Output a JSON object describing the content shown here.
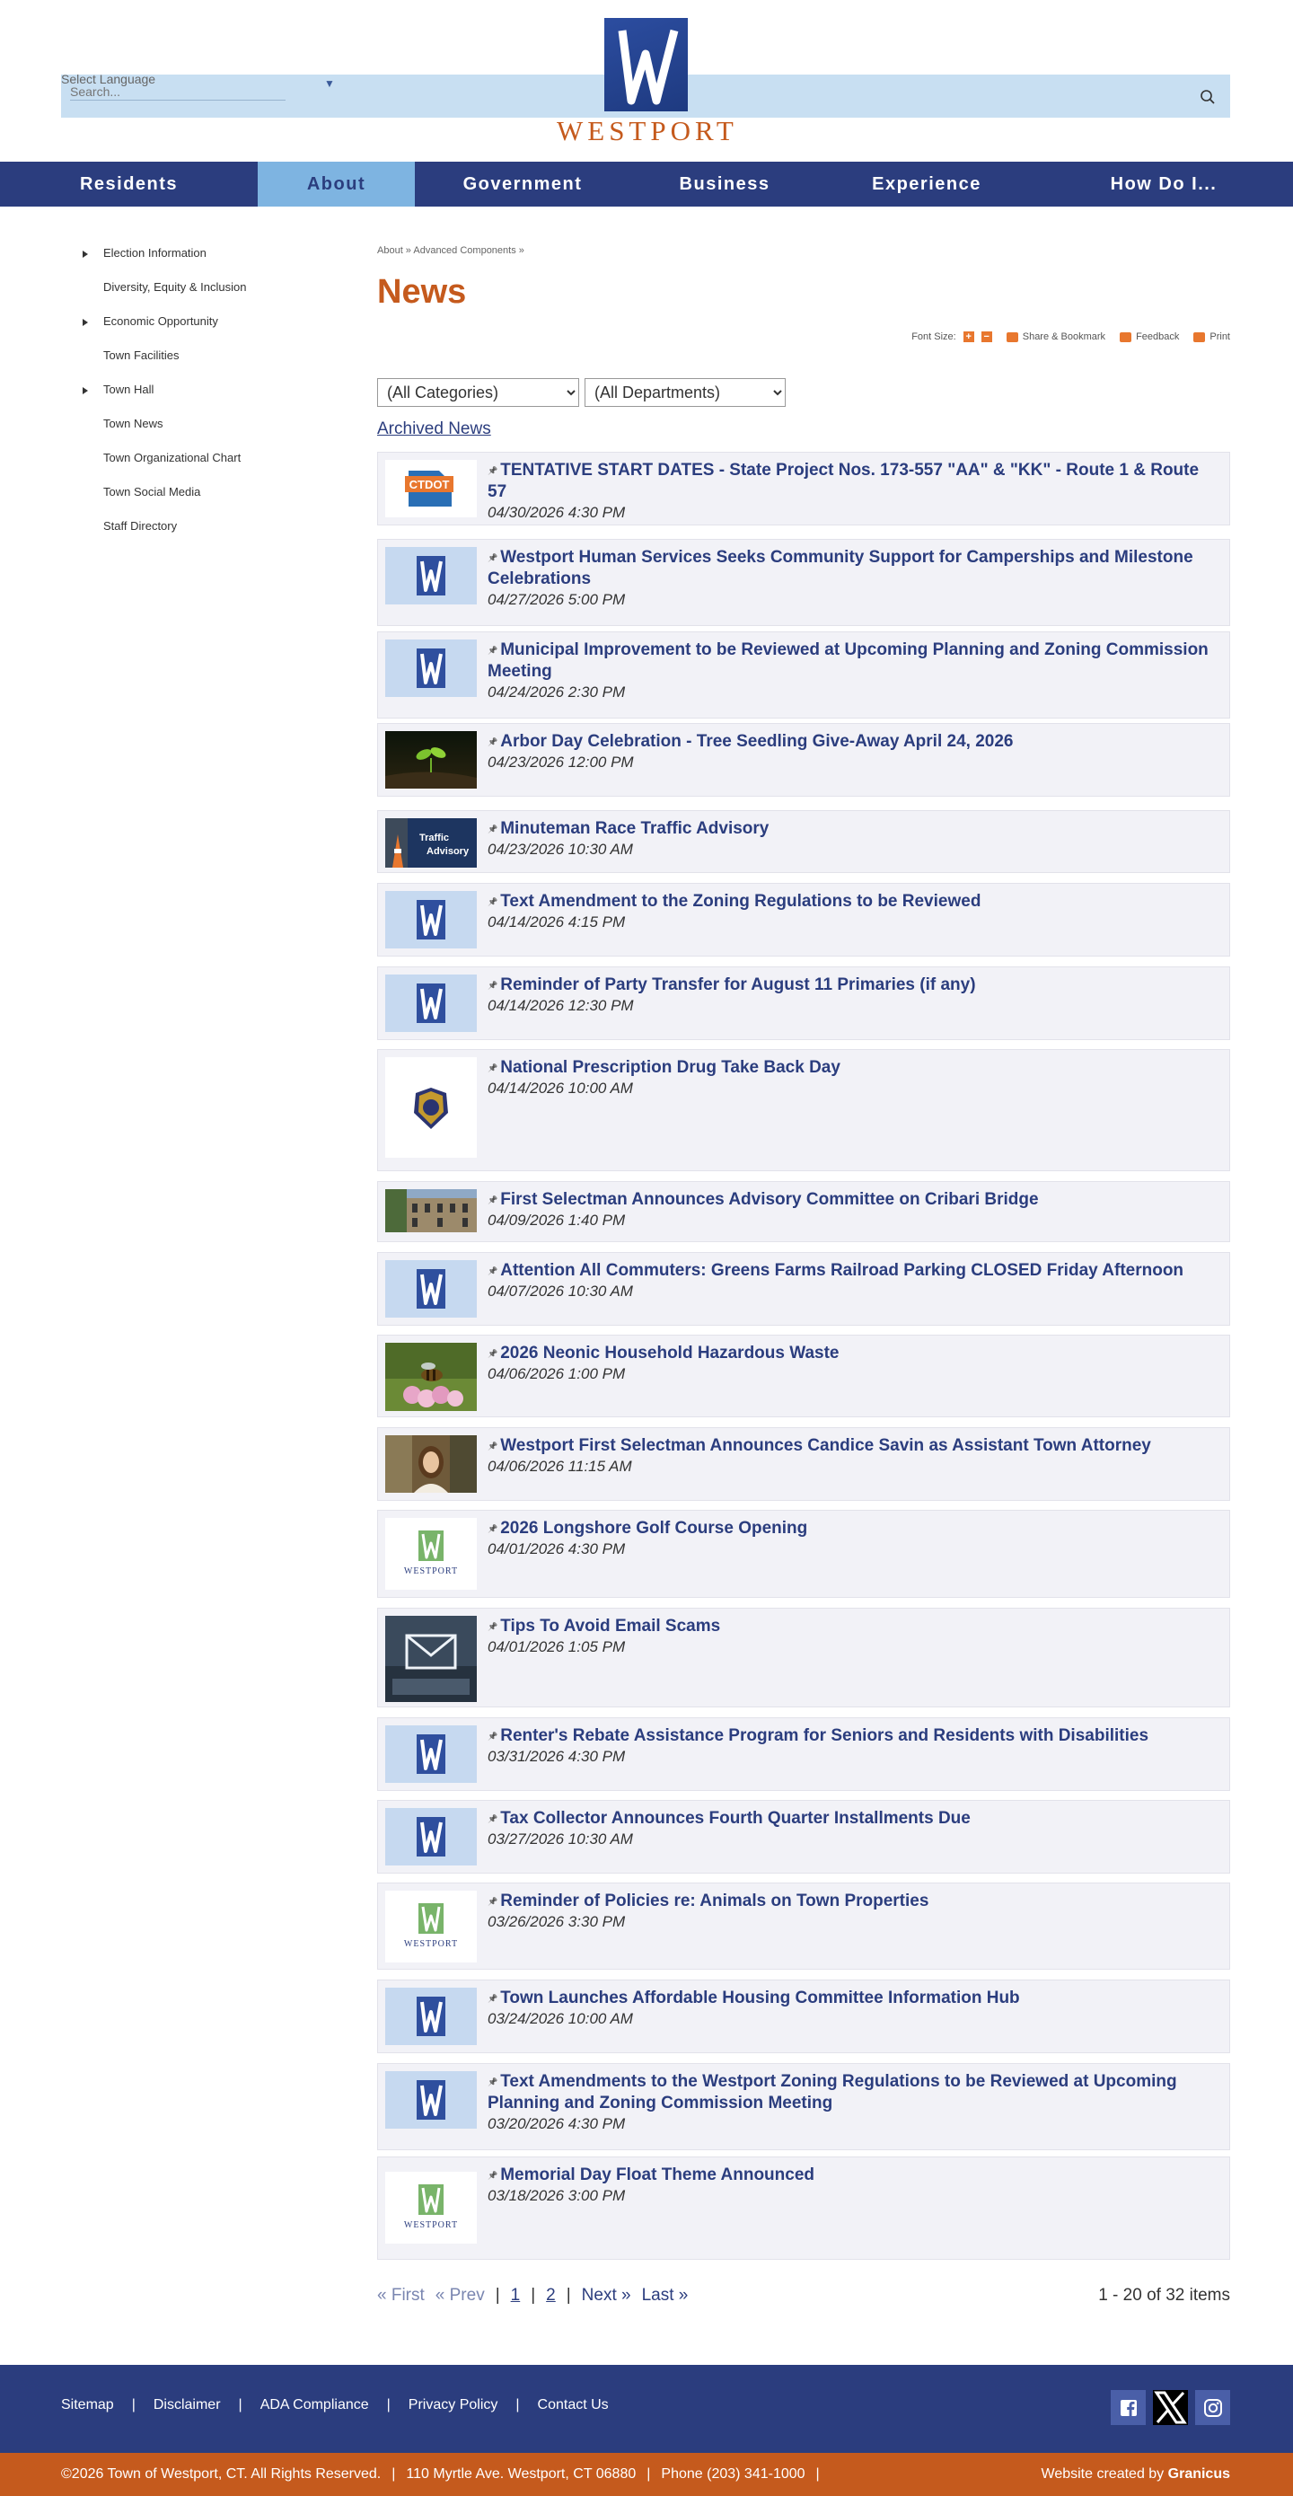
{
  "header": {
    "language_label": "Select Language",
    "search_placeholder": "Search...",
    "logo_text": "WESTPORT"
  },
  "nav": {
    "items": [
      {
        "label": "Residents"
      },
      {
        "label": "About"
      },
      {
        "label": "Government"
      },
      {
        "label": "Business"
      },
      {
        "label": "Experience"
      },
      {
        "label": "How Do I..."
      }
    ],
    "active": "About"
  },
  "sidebar": {
    "items": [
      {
        "label": "Election Information",
        "has_children": true
      },
      {
        "label": "Diversity, Equity & Inclusion",
        "has_children": false
      },
      {
        "label": "Economic Opportunity",
        "has_children": true
      },
      {
        "label": "Town Facilities",
        "has_children": false
      },
      {
        "label": "Town Hall",
        "has_children": true
      },
      {
        "label": "Town News",
        "has_children": false
      },
      {
        "label": "Town Organizational Chart",
        "has_children": false
      },
      {
        "label": "Town Social Media",
        "has_children": false
      },
      {
        "label": "Staff Directory",
        "has_children": false
      }
    ]
  },
  "main": {
    "breadcrumb": "About » Advanced Components »",
    "title": "News",
    "tools": {
      "font_size_label": "Font Size:",
      "increase": "+",
      "decrease": "−",
      "share_label": "Share & Bookmark",
      "feedback_label": "Feedback",
      "print_label": "Print"
    },
    "filters": {
      "category_selected": "(All Categories)",
      "department_selected": "(All Departments)"
    },
    "archived_label": "Archived News"
  },
  "news": [
    {
      "title": "TENTATIVE START DATES - State Project Nos. 173-557 \"AA\" & \"KK\" - Route 1 & Route 57",
      "date": "04/30/2026 4:30 PM",
      "thumb": "ctdot",
      "thumb_text": "CTDOT"
    },
    {
      "title": "Westport Human Services Seeks Community Support for Camperships and Milestone Celebrations",
      "date": "04/27/2026 5:00 PM",
      "thumb": "w-logo"
    },
    {
      "title": "Municipal Improvement to be Reviewed at Upcoming Planning and Zoning Commission Meeting",
      "date": "04/24/2026 2:30 PM",
      "thumb": "w-logo"
    },
    {
      "title": "Arbor Day Celebration - Tree Seedling Give-Away April 24, 2026",
      "date": "04/23/2026 12:00 PM",
      "thumb": "seedling"
    },
    {
      "title": "Minuteman Race Traffic Advisory",
      "date": "04/23/2026 10:30 AM",
      "thumb": "traffic",
      "thumb_text_1": "Traffic",
      "thumb_text_2": "Advisory"
    },
    {
      "title": "Text Amendment to the Zoning Regulations to be Reviewed",
      "date": "04/14/2026 4:15 PM",
      "thumb": "w-logo"
    },
    {
      "title": "Reminder of Party Transfer for August 11 Primaries (if any)",
      "date": "04/14/2026 12:30 PM",
      "thumb": "w-logo"
    },
    {
      "title": "National Prescription Drug Take Back Day",
      "date": "04/14/2026 10:00 AM",
      "thumb": "police-badge"
    },
    {
      "title": "First Selectman Announces Advisory Committee on Cribari Bridge",
      "date": "04/09/2026 1:40 PM",
      "thumb": "building"
    },
    {
      "title": "Attention All Commuters: Greens Farms Railroad Parking CLOSED Friday Afternoon",
      "date": "04/07/2026 10:30 AM",
      "thumb": "w-logo"
    },
    {
      "title": "2026 Neonic Household Hazardous Waste",
      "date": "04/06/2026 1:00 PM",
      "thumb": "bee"
    },
    {
      "title": "Westport First Selectman Announces Candice Savin as Assistant Town Attorney",
      "date": "04/06/2026 11:15 AM",
      "thumb": "portrait"
    },
    {
      "title": "2026 Longshore Golf Course Opening",
      "date": "04/01/2026 4:30 PM",
      "thumb": "westport-logo",
      "thumb_text": "WESTPORT"
    },
    {
      "title": "Tips To Avoid Email Scams",
      "date": "04/01/2026 1:05 PM",
      "thumb": "email"
    },
    {
      "title": "Renter's Rebate Assistance Program for Seniors and Residents with Disabilities",
      "date": "03/31/2026 4:30 PM",
      "thumb": "w-logo"
    },
    {
      "title": "Tax Collector Announces Fourth Quarter Installments Due",
      "date": "03/27/2026 10:30 AM",
      "thumb": "w-logo"
    },
    {
      "title": "Reminder of Policies re: Animals on Town Properties",
      "date": "03/26/2026 3:30 PM",
      "thumb": "westport-logo",
      "thumb_text": "WESTPORT"
    },
    {
      "title": "Town Launches Affordable Housing Committee Information Hub",
      "date": "03/24/2026 10:00 AM",
      "thumb": "w-logo"
    },
    {
      "title": "Text Amendments to the Westport Zoning Regulations to be Reviewed at Upcoming Planning and Zoning Commission Meeting",
      "date": "03/20/2026 4:30 PM",
      "thumb": "w-logo"
    },
    {
      "title": "Memorial Day Float Theme Announced",
      "date": "03/18/2026 3:00 PM",
      "thumb": "westport-logo",
      "thumb_text": "WESTPORT"
    }
  ],
  "pagination": {
    "first": "« First",
    "prev": "« Prev",
    "pages": [
      "1",
      "2"
    ],
    "next": "Next »",
    "last": "Last »",
    "count": "1 - 20 of 32 items"
  },
  "footer": {
    "links": [
      "Sitemap",
      "Disclaimer",
      "ADA Compliance",
      "Privacy Policy",
      "Contact Us"
    ],
    "copyright": "©2026 Town of Westport, CT. All Rights Reserved.",
    "address": "110 Myrtle Ave. Westport, CT 06880",
    "phone": "Phone (203) 341-1000",
    "credit_prefix": "Website created by",
    "credit_name": "Granicus"
  },
  "colors": {
    "navy": "#2b3d7e",
    "orange": "#c55a1d",
    "light_blue": "#c8dff2",
    "active_tab": "#7eb4e1"
  }
}
